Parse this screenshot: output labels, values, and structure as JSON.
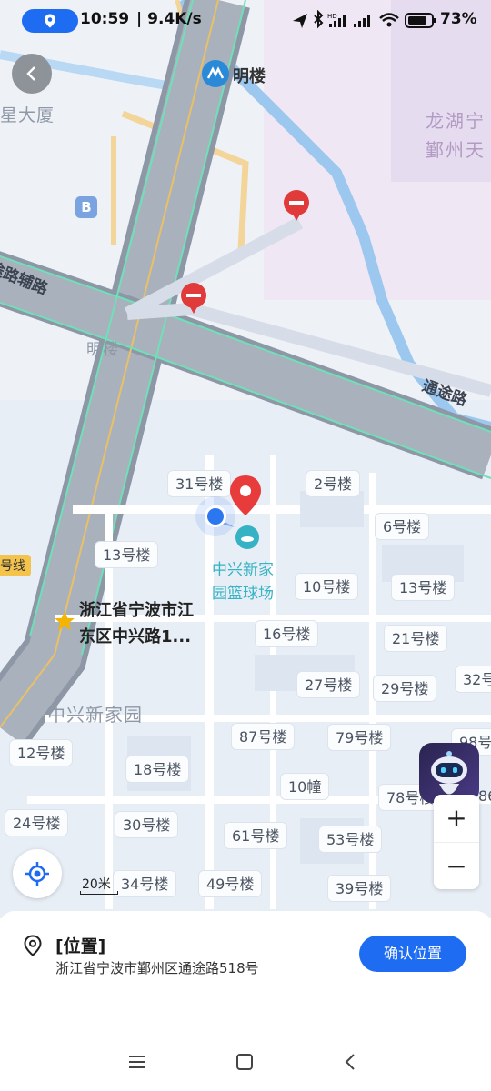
{
  "status_bar": {
    "time": "10:59",
    "net_rate": "| 9.4K/s",
    "battery_percent": "73%",
    "location_pill_color": "#1e6cf2"
  },
  "map": {
    "poi": {
      "minglou_station": "明楼",
      "minglou_crossing": "明楼",
      "partial_building_left": "星大厦",
      "longhu_line1": "龙湖宁",
      "longhu_line2": "鄞州天",
      "zhongxing_park": "中兴新家园",
      "court_line1": "中兴新家",
      "court_line2": "园篮球场",
      "favorite_line1": "浙江省宁波市江",
      "favorite_line2": "东区中兴路1...",
      "metro_line_label": "号线",
      "bus_badge": "B"
    },
    "roads": {
      "aux_road": "途路辅路",
      "tongtu_road": "通途路"
    },
    "buildings": [
      {
        "label": "31号楼"
      },
      {
        "label": "2号楼"
      },
      {
        "label": "6号楼"
      },
      {
        "label": "13号楼"
      },
      {
        "label": "10号楼"
      },
      {
        "label": "13号楼"
      },
      {
        "label": "16号楼"
      },
      {
        "label": "21号楼"
      },
      {
        "label": "27号楼"
      },
      {
        "label": "29号楼"
      },
      {
        "label": "32号"
      },
      {
        "label": "87号楼"
      },
      {
        "label": "79号楼"
      },
      {
        "label": "98号"
      },
      {
        "label": "12号楼"
      },
      {
        "label": "18号楼"
      },
      {
        "label": "10幢"
      },
      {
        "label": "78号楼"
      },
      {
        "label": "24号楼"
      },
      {
        "label": "30号楼"
      },
      {
        "label": "61号楼"
      },
      {
        "label": "53号楼"
      },
      {
        "label": "34号楼"
      },
      {
        "label": "49号楼"
      },
      {
        "label": "39号楼"
      },
      {
        "label": "86"
      }
    ],
    "scale_label": "20米",
    "zoom_in": "+",
    "zoom_out": "−"
  },
  "location_card": {
    "title": "[位置]",
    "address": "浙江省宁波市鄞州区通途路518号",
    "confirm_button": "确认位置",
    "accent_color": "#1e6cf2"
  },
  "icons": {
    "location_pill": "location-pin-icon",
    "back": "chevron-left-icon",
    "red_marker": "map-pin-icon",
    "no_entry": "no-entry-icon",
    "metro": "metro-icon",
    "favorite": "star-icon",
    "user_location": "blue-dot-icon",
    "locate": "crosshair-icon",
    "assistant": "robot-icon",
    "card_location": "location-outline-icon",
    "nav_menu": "menu-icon",
    "nav_home": "square-icon",
    "nav_back": "chevron-left-icon"
  }
}
